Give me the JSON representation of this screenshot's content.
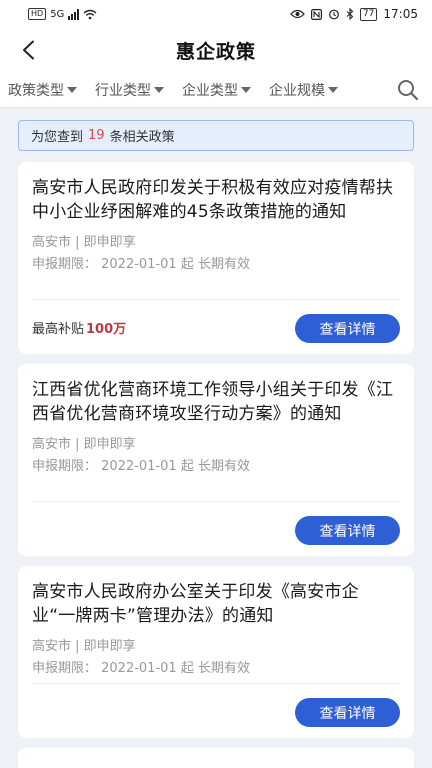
{
  "status_bar": {
    "network": "HD",
    "signal_type": "5G",
    "battery": "77",
    "time": "17:05"
  },
  "header": {
    "back_icon": "chevron-left-icon",
    "title": "惠企政策"
  },
  "filters": [
    {
      "label": "政策类型"
    },
    {
      "label": "行业类型"
    },
    {
      "label": "企业类型"
    },
    {
      "label": "企业规模"
    }
  ],
  "search_icon": "search-icon",
  "result": {
    "prefix": "为您查到",
    "count": "19",
    "suffix": "条相关政策"
  },
  "policies": [
    {
      "title": "高安市人民政府印发关于积极有效应对疫情帮扶中小企业纾困解难的45条政策措施的通知",
      "source": "高安市 | 即申即享",
      "period": "申报期限：  2022-01-01 起 长期有效",
      "subsidy_label": "最高补贴",
      "subsidy_amount": "100万",
      "button": "查看详情"
    },
    {
      "title": "江西省优化营商环境工作领导小组关于印发《江西省优化营商环境攻坚行动方案》的通知",
      "source": "高安市 | 即申即享",
      "period": "申报期限：  2022-01-01 起 长期有效",
      "subsidy_label": "",
      "subsidy_amount": "",
      "button": "查看详情"
    },
    {
      "title": "高安市人民政府办公室关于印发《高安市企业“一牌两卡”管理办法》的通知",
      "source": "高安市 | 即申即享",
      "period": "申报期限：  2022-01-01 起 长期有效",
      "subsidy_label": "",
      "subsidy_amount": "",
      "button": "查看详情"
    }
  ],
  "colors": {
    "primary": "#2f5fd4",
    "highlight": "#e0454d",
    "amount": "#c0383f",
    "background": "#eef1f6"
  }
}
